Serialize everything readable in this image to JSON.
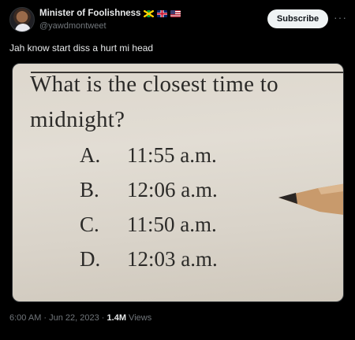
{
  "author": {
    "display_name": "Minister of Foolishness",
    "handle": "@yawdmontweet",
    "flags": [
      "jamaica-flag",
      "uk-flag",
      "us-flag"
    ]
  },
  "actions": {
    "subscribe_label": "Subscribe",
    "more_label": "···"
  },
  "tweet": {
    "text": "Jah know start diss a hurt mi head"
  },
  "image": {
    "question_line1": "What is the closest time to",
    "question_line2": "midnight?",
    "options": [
      {
        "letter": "A.",
        "value": "11:55 a.m."
      },
      {
        "letter": "B.",
        "value": "12:06 a.m."
      },
      {
        "letter": "C.",
        "value": "11:50 a.m."
      },
      {
        "letter": "D.",
        "value": "12:03 a.m."
      }
    ]
  },
  "meta": {
    "timestamp": "6:00 AM · Jun 22, 2023 · ",
    "views_count": "1.4M",
    "views_label": " Views"
  },
  "colors": {
    "background": "#000000",
    "text_primary": "#e7e9ea",
    "text_secondary": "#71767b",
    "subscribe_bg": "#eff3f4",
    "paper": "#ddd7cd"
  }
}
